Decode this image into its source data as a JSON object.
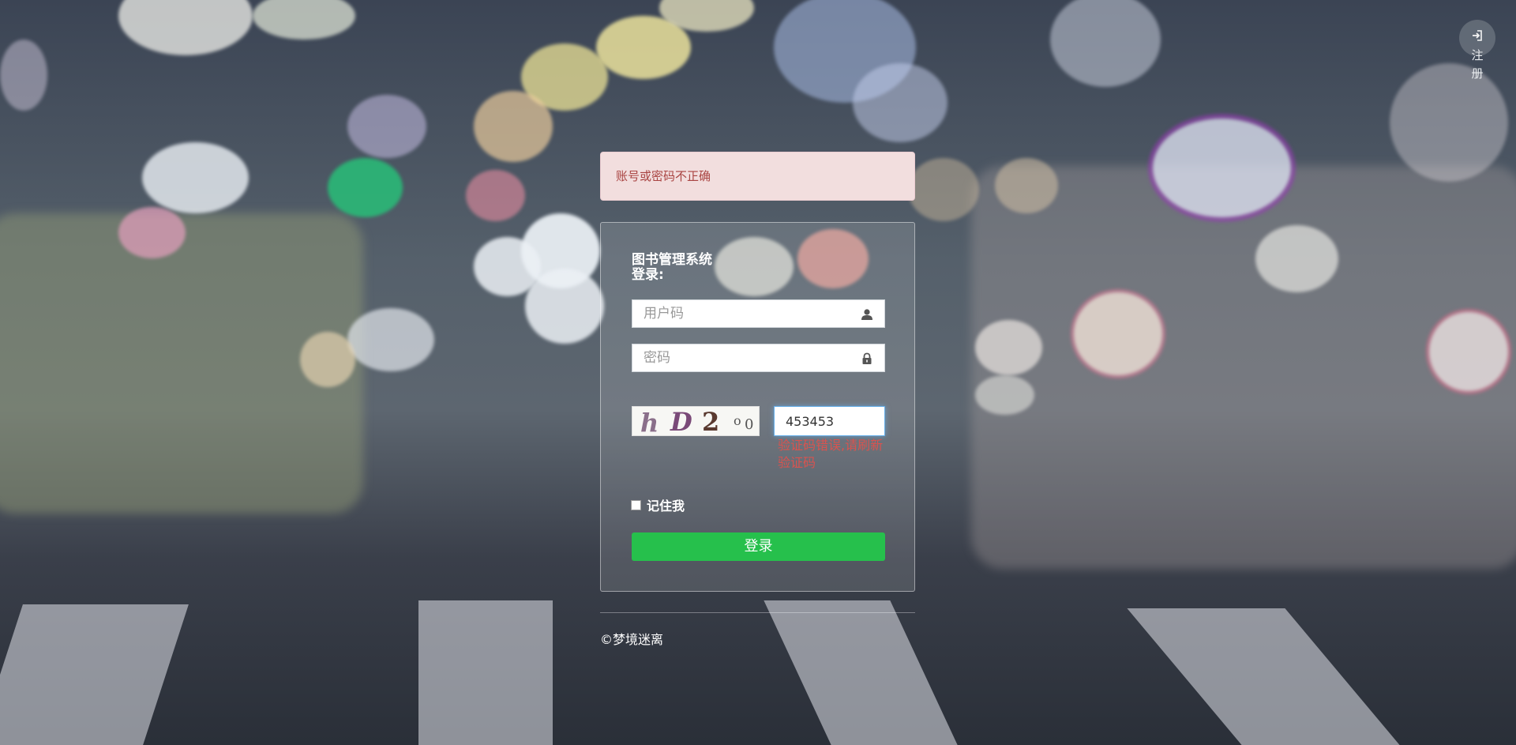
{
  "register": {
    "icon": "sign-in-icon",
    "label_line1": "注",
    "label_line2": "册"
  },
  "alert": {
    "message": "账号或密码不正确"
  },
  "login": {
    "title": "图书管理系统",
    "subtitle": "登录:",
    "username_placeholder": "用户码",
    "username_icon": "user-icon",
    "password_placeholder": "密码",
    "password_icon": "lock-icon",
    "captcha_chars": [
      "h",
      "D",
      "2",
      "o",
      "0"
    ],
    "captcha_value": "453453",
    "captcha_error": "验证码错误,请刷新验证码",
    "remember_label": "记住我",
    "submit_label": "登录"
  },
  "footer": {
    "text": "©梦境迷离"
  },
  "colors": {
    "alert_bg": "#f2dede",
    "alert_text": "#a94442",
    "login_button": "#26c04c",
    "error_text": "#d9534f"
  }
}
